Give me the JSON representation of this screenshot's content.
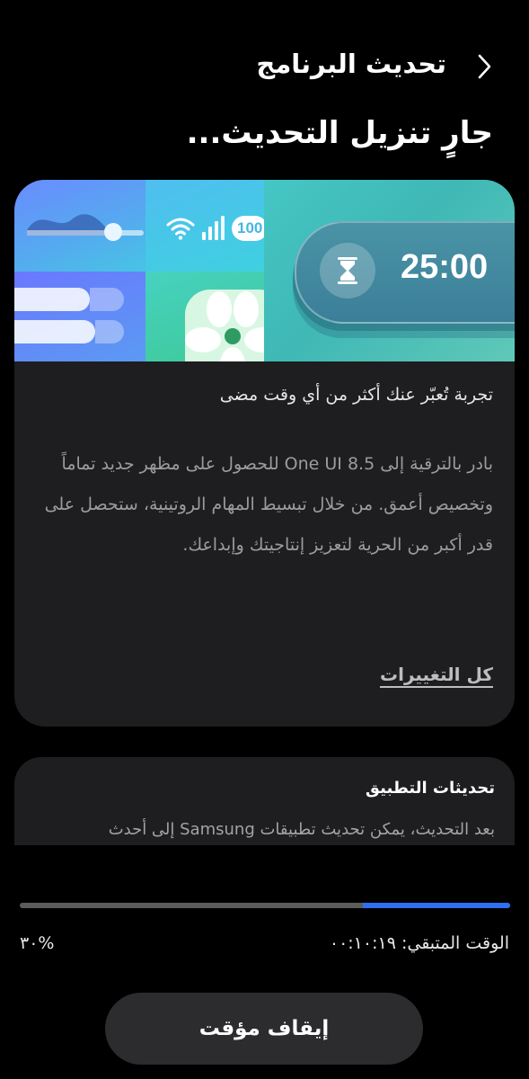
{
  "header": {
    "title": "تحديث البرنامج",
    "back_icon": "chevron-right-icon"
  },
  "page_title": "جارٍ تنزيل التحديث...",
  "hero": {
    "timer_text": "25:00",
    "battery_text": "100",
    "icons": [
      "wave-slider-icon",
      "wifi-icon",
      "signal-icon",
      "battery-icon",
      "fan-icon",
      "hourglass-icon"
    ]
  },
  "info_card": {
    "tagline": "تجربة تُعبّر عنك أكثر من أي وقت مضى",
    "description": "بادر بالترقية إلى One UI 8.5 للحصول على مظهر جديد تماماً وتخصيص أعمق. من خلال تبسيط المهام الروتينية، ستحصل على قدر أكبر من الحرية لتعزيز إنتاجيتك وإبداعك.",
    "all_changes_link": "كل التغييرات"
  },
  "app_updates": {
    "title": "تحديثات التطبيق",
    "description": "بعد التحديث، يمكن تحديث تطبيقات Samsung إلى أحدث"
  },
  "progress": {
    "fraction": 0.3,
    "time_remaining": "الوقت المتبقي: ٠٠:١٠:١٩",
    "percent_text": "%٣٠",
    "track_color": "#5c5c5c",
    "fill_color": "#2f6ff0"
  },
  "pause_button_label": "إيقاف مؤقت"
}
